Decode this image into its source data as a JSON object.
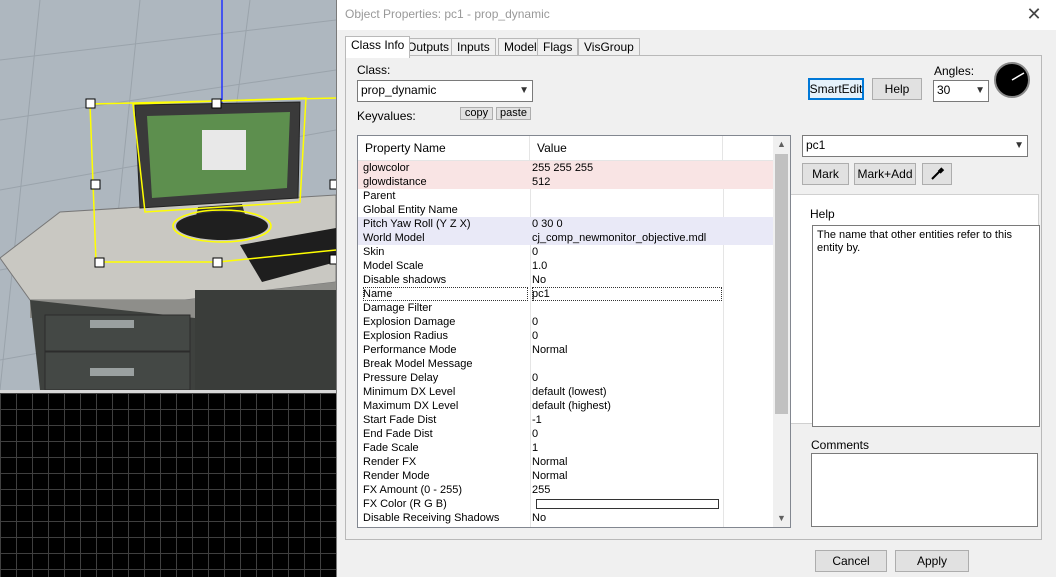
{
  "dialog": {
    "title": "Object Properties: pc1 - prop_dynamic",
    "close_glyph": "✕"
  },
  "tabs": [
    {
      "label": "Class Info",
      "active": true
    },
    {
      "label": "Outputs"
    },
    {
      "label": "Inputs"
    },
    {
      "label": "Model"
    },
    {
      "label": "Flags"
    },
    {
      "label": "VisGroup"
    }
  ],
  "class_section": {
    "class_label": "Class:",
    "class_value": "prop_dynamic",
    "keyvalues_label": "Keyvalues:",
    "copy_label": "copy",
    "paste_label": "paste"
  },
  "toolbar": {
    "smartedit_label": "SmartEdit",
    "help_label": "Help",
    "angles_label": "Angles:",
    "angles_value": "30"
  },
  "grid": {
    "col_property": "Property Name",
    "col_value": "Value",
    "rows": [
      {
        "k": "glowcolor",
        "v": "255 255 255",
        "hl": "red"
      },
      {
        "k": "glowdistance",
        "v": "512",
        "hl": "red"
      },
      {
        "k": "Parent",
        "v": ""
      },
      {
        "k": "Global Entity Name",
        "v": ""
      },
      {
        "k": "Pitch Yaw Roll (Y Z X)",
        "v": "0 30 0",
        "hl": "blue"
      },
      {
        "k": "World Model",
        "v": "cj_comp_newmonitor_objective.mdl",
        "hl": "blue"
      },
      {
        "k": "Skin",
        "v": "0"
      },
      {
        "k": "Model Scale",
        "v": "1.0"
      },
      {
        "k": "Disable shadows",
        "v": "No"
      },
      {
        "k": "Name",
        "v": "pc1",
        "sel": true
      },
      {
        "k": "Damage Filter",
        "v": ""
      },
      {
        "k": "Explosion Damage",
        "v": "0"
      },
      {
        "k": "Explosion Radius",
        "v": "0"
      },
      {
        "k": "Performance Mode",
        "v": "Normal"
      },
      {
        "k": "Break Model Message",
        "v": ""
      },
      {
        "k": "Pressure Delay",
        "v": "0"
      },
      {
        "k": "Minimum DX Level",
        "v": "default (lowest)"
      },
      {
        "k": "Maximum DX Level",
        "v": "default (highest)"
      },
      {
        "k": "Start Fade Dist",
        "v": "-1"
      },
      {
        "k": "End Fade Dist",
        "v": "0"
      },
      {
        "k": "Fade Scale",
        "v": "1"
      },
      {
        "k": "Render FX",
        "v": "Normal"
      },
      {
        "k": "Render Mode",
        "v": "Normal"
      },
      {
        "k": "FX Amount (0 - 255)",
        "v": "255"
      },
      {
        "k": "FX Color (R G B)",
        "v": "",
        "colorbox": true
      },
      {
        "k": "Disable Receiving Shadows",
        "v": "No"
      }
    ]
  },
  "editor": {
    "value_field": "pc1",
    "mark_label": "Mark",
    "mark_add_label": "Mark+Add",
    "help_label": "Help",
    "help_text": "The name that other entities refer to this entity by.",
    "comments_label": "Comments",
    "comments_text": ""
  },
  "footer": {
    "cancel_label": "Cancel",
    "apply_label": "Apply"
  },
  "colors": {
    "selection_yellow": "#ffff00",
    "row_highlight_red": "#f9e4e4",
    "row_highlight_blue": "#e9e9f7"
  }
}
